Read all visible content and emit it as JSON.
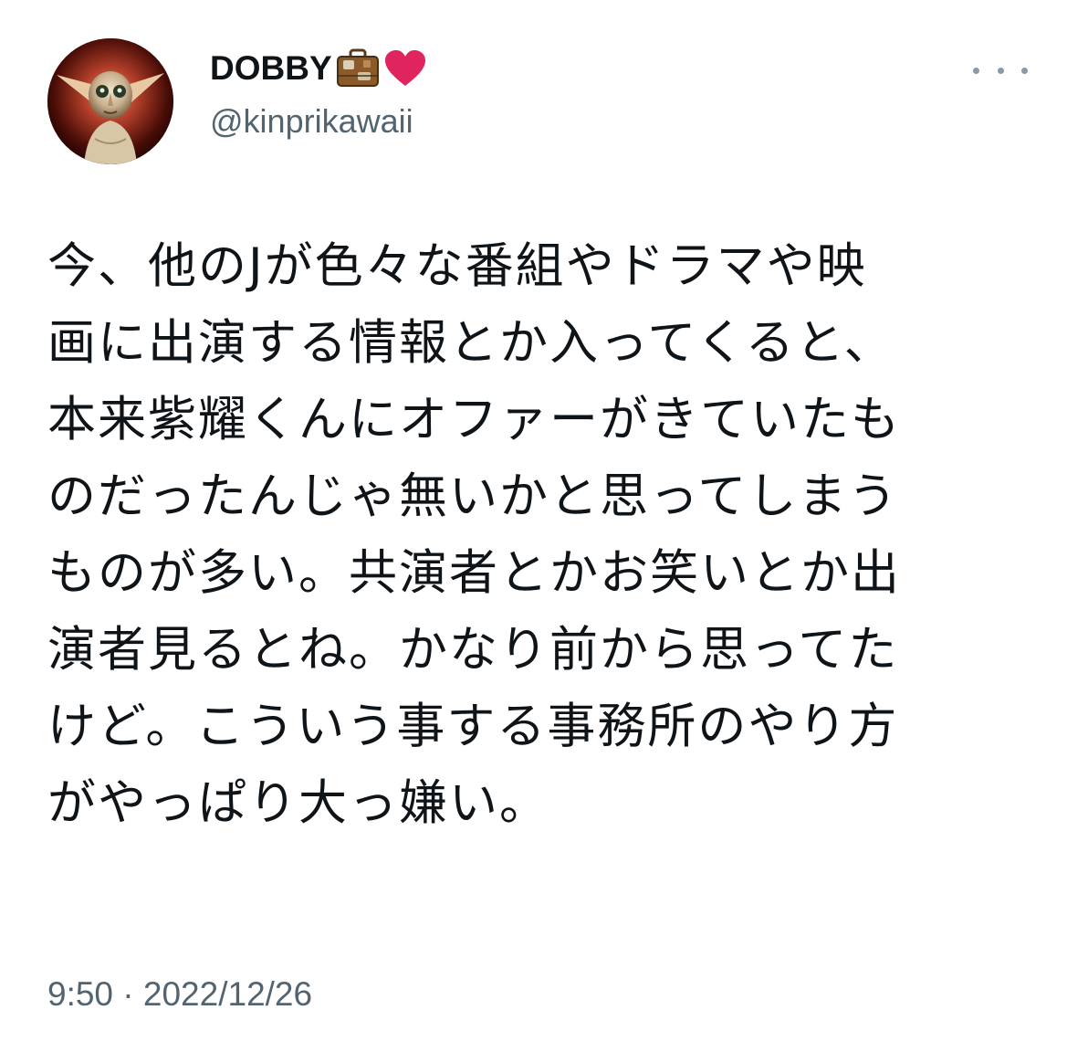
{
  "tweet": {
    "author": {
      "display_name": "DOBBY",
      "name_emojis": [
        "suitcase-icon",
        "red-heart-icon"
      ],
      "handle": "@kinprikawaii",
      "avatar": "avatar-dobby"
    },
    "text_lines": [
      "今、他のJが色々な番組やドラマや映",
      "画に出演する情報とか入ってくると、",
      "本来紫耀くんにオファーがきていたも",
      "のだったんじゃ無いかと思ってしまう",
      "ものが多い。共演者とかお笑いとか出",
      "演者見るとね。かなり前から思ってた",
      "けど。こういう事する事務所のやり方",
      "がやっぱり大っ嫌い。"
    ],
    "time": "9:50",
    "separator": "·",
    "date": "2022/12/26"
  },
  "colors": {
    "text_primary": "#0f1419",
    "text_secondary": "#536471",
    "heart": "#e0245e",
    "suitcase": "#8a5a2b"
  }
}
